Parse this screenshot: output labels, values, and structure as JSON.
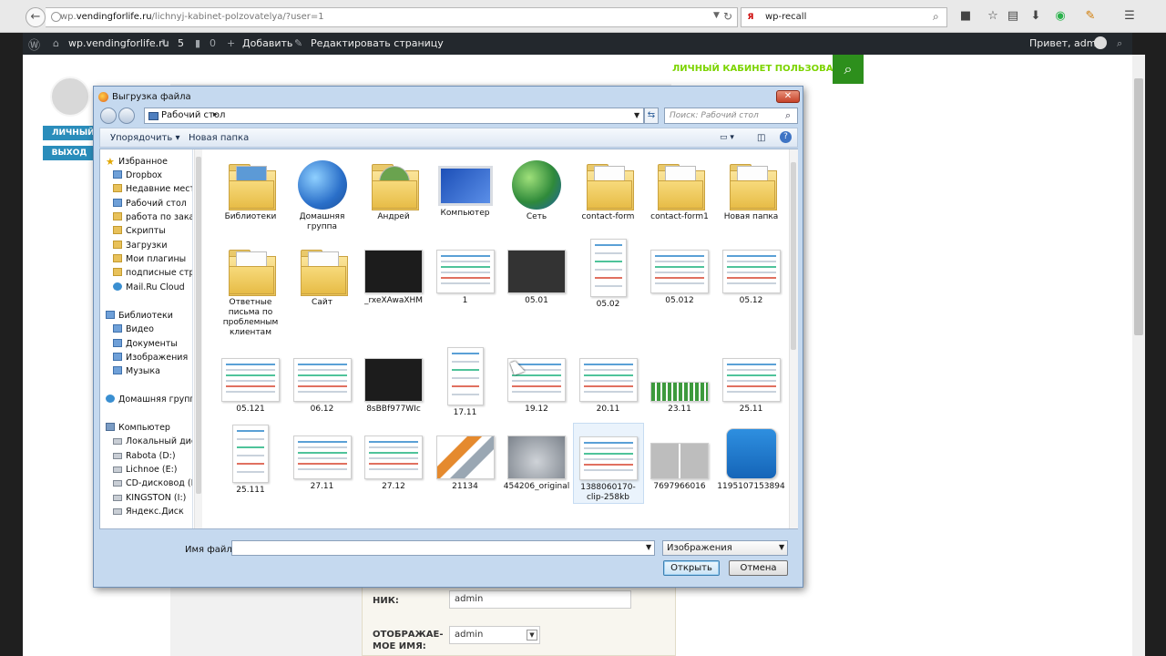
{
  "browser": {
    "url_prefix": "wp.",
    "url_domain": "vendingforlife.ru",
    "url_path": "/lichnyj-kabinet-polzovatelya/?user=1",
    "search_engine": "Я",
    "search_text": "wp-recall"
  },
  "adminbar": {
    "site_name": "wp.vendingforlife.ru",
    "updates_count": "5",
    "comments_count": "0",
    "add_label": "Добавить",
    "edit_label": "Редактировать страницу",
    "greeting": "Привет, admin"
  },
  "page": {
    "nav_title": "ЛИЧНЫЙ КАБИНЕТ ПОЛЬЗОВАТЕЛЯ",
    "cabinet_button": "ЛИЧНЫЙ КАБИНЕТ",
    "logout_button": "ВЫХОД",
    "nick_label": "НИК:",
    "nick_value": "admin",
    "display_name_label_1": "ОТОБРАЖАЕ-",
    "display_name_label_2": "МОЕ ИМЯ:",
    "display_name_value": "admin"
  },
  "dialog": {
    "title": "Выгрузка файла",
    "address": "Рабочий стол",
    "search_placeholder": "Поиск: Рабочий стол",
    "organize": "Упорядочить",
    "new_folder": "Новая папка",
    "nav": {
      "favorites": "Избранное",
      "favorites_items": [
        "Dropbox",
        "Недавние места",
        "Рабочий стол",
        "работа по заказу",
        "Скрипты",
        "Загрузки",
        "Мои плагины",
        "подписные стра",
        "Mail.Ru Cloud"
      ],
      "libraries": "Библиотеки",
      "library_items": [
        "Видео",
        "Документы",
        "Изображения",
        "Музыка"
      ],
      "homegroup": "Домашняя группа",
      "computer": "Компьютер",
      "computer_items": [
        "Локальный диск",
        "Rabota (D:)",
        "Lichnoe (E:)",
        "CD-дисковод (H",
        "KINGSTON (I:)",
        "Яндекс.Диск"
      ]
    },
    "files": [
      {
        "name": "Библиотеки",
        "kind": "library"
      },
      {
        "name": "Домашняя группа",
        "kind": "homegroup"
      },
      {
        "name": "Андрей",
        "kind": "user-folder"
      },
      {
        "name": "Компьютер",
        "kind": "computer"
      },
      {
        "name": "Сеть",
        "kind": "network"
      },
      {
        "name": "contact-form",
        "kind": "folder"
      },
      {
        "name": "contact-form1",
        "kind": "folder"
      },
      {
        "name": "Новая папка",
        "kind": "folder"
      },
      {
        "name": "Ответные письма по проблемным клиентам",
        "kind": "folder"
      },
      {
        "name": "Сайт",
        "kind": "folder"
      },
      {
        "name": "_rxeXAwaXHM",
        "kind": "photo-dark"
      },
      {
        "name": "1",
        "kind": "screenshot"
      },
      {
        "name": "05.01",
        "kind": "screenshot-dark"
      },
      {
        "name": "05.02",
        "kind": "screenshot-tall"
      },
      {
        "name": "05.012",
        "kind": "screenshot"
      },
      {
        "name": "05.12",
        "kind": "screenshot"
      },
      {
        "name": "05.121",
        "kind": "screenshot"
      },
      {
        "name": "06.12",
        "kind": "screenshot"
      },
      {
        "name": "8sBBf977WIc",
        "kind": "photo-dark"
      },
      {
        "name": "17.11",
        "kind": "screenshot-tall"
      },
      {
        "name": "19.12",
        "kind": "screenshot"
      },
      {
        "name": "20.11",
        "kind": "screenshot"
      },
      {
        "name": "23.11",
        "kind": "green-grid"
      },
      {
        "name": "25.11",
        "kind": "screenshot"
      },
      {
        "name": "25.111",
        "kind": "screenshot-tall"
      },
      {
        "name": "27.11",
        "kind": "screenshot"
      },
      {
        "name": "27.12",
        "kind": "screenshot"
      },
      {
        "name": "21134",
        "kind": "tools"
      },
      {
        "name": "454206_original",
        "kind": "lock"
      },
      {
        "name": "1388060170-clip-258kb",
        "kind": "screenshot"
      },
      {
        "name": "7697966016",
        "kind": "gray-icons"
      },
      {
        "name": "1195107153894",
        "kind": "cart-icon"
      }
    ],
    "filename_label": "Имя файла:",
    "filename_value": "",
    "filter": "Изображения",
    "open": "Открыть",
    "cancel": "Отмена"
  }
}
